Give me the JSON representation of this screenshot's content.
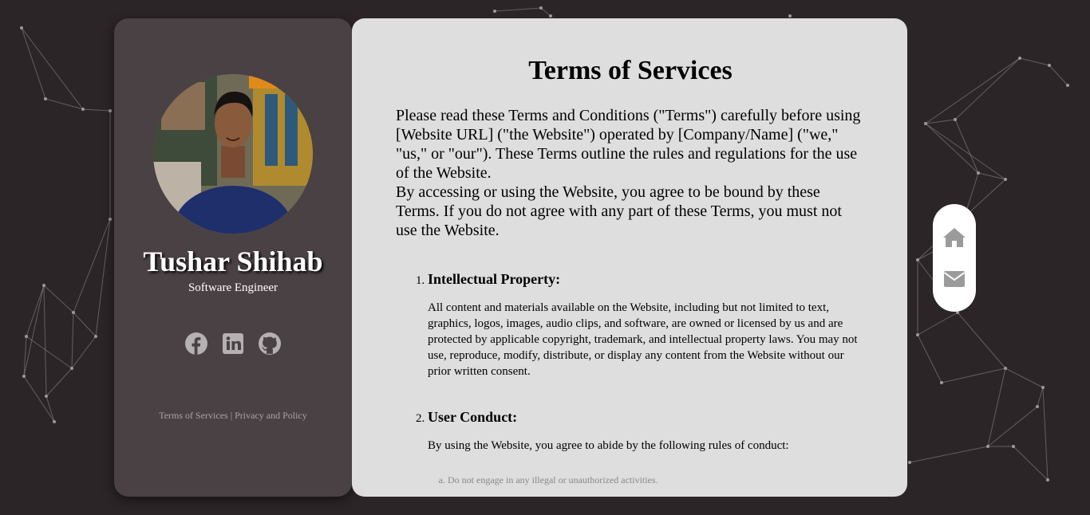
{
  "profile": {
    "name": "Tushar Shihab",
    "role": "Software Engineer",
    "avatar_alt": "profile photo",
    "socials": [
      {
        "label": "Facebook",
        "icon": "facebook-icon"
      },
      {
        "label": "LinkedIn",
        "icon": "linkedin-icon"
      },
      {
        "label": "GitHub",
        "icon": "github-icon"
      }
    ],
    "footer": {
      "terms": "Terms of Services",
      "separator": "|",
      "privacy": "Privacy and Policy"
    }
  },
  "content": {
    "title": "Terms of Services",
    "intro_1": "Please read these Terms and Conditions (\"Terms\") carefully before using [Website URL] (\"the Website\") operated by [Company/Name] (\"we,\" \"us,\" or \"our\"). These Terms outline the rules and regulations for the use of the Website.",
    "intro_2": "By accessing or using the Website, you agree to be bound by these Terms. If you do not agree with any part of these Terms, you must not use the Website.",
    "sections": [
      {
        "title": "Intellectual Property:",
        "body": "All content and materials available on the Website, including but not limited to text, graphics, logos, images, audio clips, and software, are owned or licensed by us and are protected by applicable copyright, trademark, and intellectual property laws. You may not use, reproduce, modify, distribute, or display any content from the Website without our prior written consent."
      },
      {
        "title": "User Conduct:",
        "body": "By using the Website, you agree to abide by the following rules of conduct:",
        "items": [
          "Do not engage in any illegal or unauthorized activities."
        ]
      }
    ]
  },
  "side_nav": {
    "items": [
      {
        "label": "Home",
        "icon": "home-icon"
      },
      {
        "label": "Contact",
        "icon": "envelope-icon"
      }
    ]
  },
  "colors": {
    "page_bg": "#2c2528",
    "profile_card_bg": "#4a4144",
    "content_card_bg": "#dedede",
    "icon_gray": "#b5b0b2",
    "nav_icon_gray": "#9b9b9b"
  }
}
